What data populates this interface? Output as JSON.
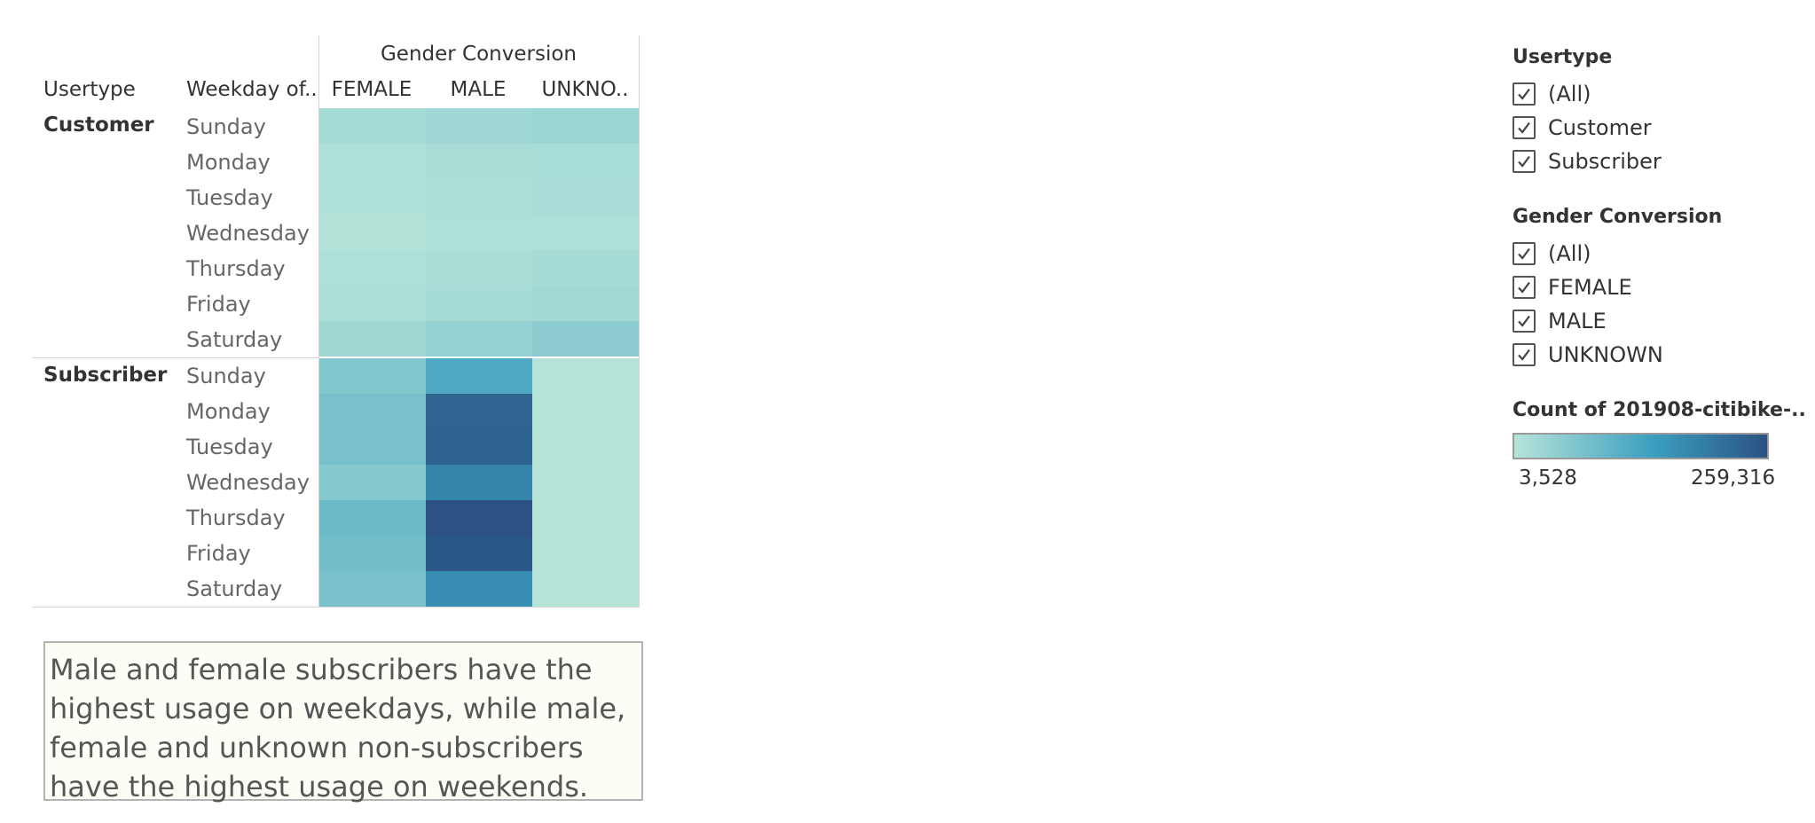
{
  "chart_data": {
    "type": "heatmap",
    "column_group_title": "Gender Conversion",
    "row_headers": [
      "Usertype",
      "Weekday of.."
    ],
    "columns": [
      "FEMALE",
      "MALE",
      "UNKNO.."
    ],
    "groups": [
      {
        "name": "Customer",
        "days": [
          "Sunday",
          "Monday",
          "Tuesday",
          "Wednesday",
          "Thursday",
          "Friday",
          "Saturday"
        ],
        "values": [
          [
            22000,
            30000,
            36000
          ],
          [
            12000,
            18000,
            20000
          ],
          [
            10000,
            16000,
            17000
          ],
          [
            8000,
            12000,
            12000
          ],
          [
            12000,
            18000,
            22000
          ],
          [
            14000,
            22000,
            26000
          ],
          [
            28000,
            42000,
            52000
          ]
        ]
      },
      {
        "name": "Subscriber",
        "days": [
          "Sunday",
          "Monday",
          "Tuesday",
          "Wednesday",
          "Thursday",
          "Friday",
          "Saturday"
        ],
        "values": [
          [
            62000,
            125000,
            5000
          ],
          [
            74000,
            232000,
            4500
          ],
          [
            74000,
            236000,
            4000
          ],
          [
            58000,
            182000,
            4000
          ],
          [
            88000,
            259316,
            4000
          ],
          [
            80000,
            250000,
            4000
          ],
          [
            74000,
            170000,
            3528
          ]
        ]
      }
    ],
    "color_min": 3528,
    "color_max": 259316,
    "color_stops": [
      "#b6e4d9",
      "#3b9fbf",
      "#2b5283"
    ]
  },
  "annotation": "Male and female subscribers have the highest usage on weekdays, while male, female and unknown non-subscribers have the highest usage on weekends.",
  "filters": [
    {
      "title": "Usertype",
      "items": [
        "(All)",
        "Customer",
        "Subscriber"
      ]
    },
    {
      "title": "Gender Conversion",
      "items": [
        "(All)",
        "FEMALE",
        "MALE",
        "UNKNOWN"
      ]
    }
  ],
  "legend": {
    "title": "Count of 201908-citibike-..",
    "min_label": "3,528",
    "max_label": "259,316"
  }
}
